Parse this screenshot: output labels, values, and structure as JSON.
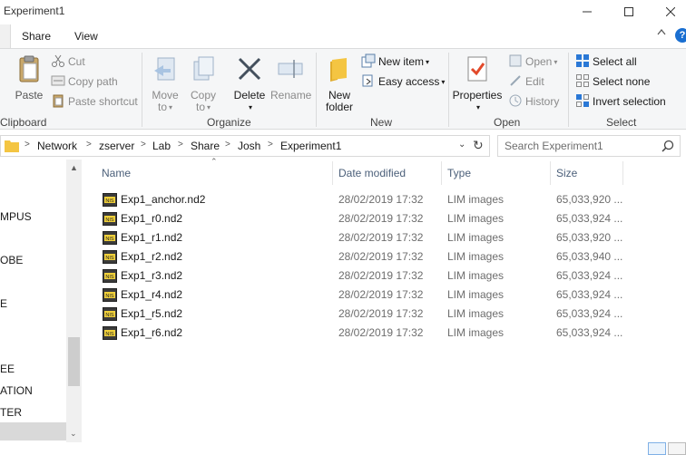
{
  "window": {
    "title": "Experiment1"
  },
  "window_controls": {
    "minimize": "—",
    "maximize": "☐",
    "close": "✕"
  },
  "tabs": [
    {
      "label": "Share"
    },
    {
      "label": "View"
    }
  ],
  "ribbon": {
    "clipboard": {
      "paste": "Paste",
      "cut": "Cut",
      "copy_path": "Copy path",
      "paste_shortcut": "Paste shortcut",
      "group_label": "Clipboard"
    },
    "organize": {
      "move_to_1": "Move",
      "move_to_2": "to",
      "copy_to_1": "Copy",
      "copy_to_2": "to",
      "delete": "Delete",
      "rename": "Rename",
      "group_label": "Organize"
    },
    "new": {
      "new_folder_1": "New",
      "new_folder_2": "folder",
      "new_item": "New item",
      "easy_access": "Easy access",
      "group_label": "New"
    },
    "open": {
      "properties": "Properties",
      "open": "Open",
      "edit": "Edit",
      "history": "History",
      "group_label": "Open"
    },
    "select": {
      "select_all": "Select all",
      "select_none": "Select none",
      "invert_selection": "Invert selection",
      "group_label": "Select"
    },
    "help": "?"
  },
  "address": {
    "crumbs": [
      "Network",
      "zserver",
      "Lab",
      "Share",
      "Josh",
      "Experiment1"
    ]
  },
  "search": {
    "placeholder": "Search Experiment1"
  },
  "nav": {
    "items": [
      "MPUS",
      "OBE",
      "E",
      "EE",
      "ATION",
      "TER"
    ]
  },
  "columns": {
    "name": "Name",
    "date": "Date modified",
    "type": "Type",
    "size": "Size"
  },
  "files": [
    {
      "name": "Exp1_anchor.nd2",
      "date": "28/02/2019 17:32",
      "type": "LIM images",
      "size": "65,033,920 ..."
    },
    {
      "name": "Exp1_r0.nd2",
      "date": "28/02/2019 17:32",
      "type": "LIM images",
      "size": "65,033,924 ..."
    },
    {
      "name": "Exp1_r1.nd2",
      "date": "28/02/2019 17:32",
      "type": "LIM images",
      "size": "65,033,920 ..."
    },
    {
      "name": "Exp1_r2.nd2",
      "date": "28/02/2019 17:32",
      "type": "LIM images",
      "size": "65,033,940 ..."
    },
    {
      "name": "Exp1_r3.nd2",
      "date": "28/02/2019 17:32",
      "type": "LIM images",
      "size": "65,033,924 ..."
    },
    {
      "name": "Exp1_r4.nd2",
      "date": "28/02/2019 17:32",
      "type": "LIM images",
      "size": "65,033,924 ..."
    },
    {
      "name": "Exp1_r5.nd2",
      "date": "28/02/2019 17:32",
      "type": "LIM images",
      "size": "65,033,924 ..."
    },
    {
      "name": "Exp1_r6.nd2",
      "date": "28/02/2019 17:32",
      "type": "LIM images",
      "size": "65,033,924 ..."
    }
  ],
  "file_icon_text": "NIS",
  "colors": {
    "accent": "#1a6fd1",
    "folder": "#f4c542",
    "header_text": "#4c607a"
  }
}
